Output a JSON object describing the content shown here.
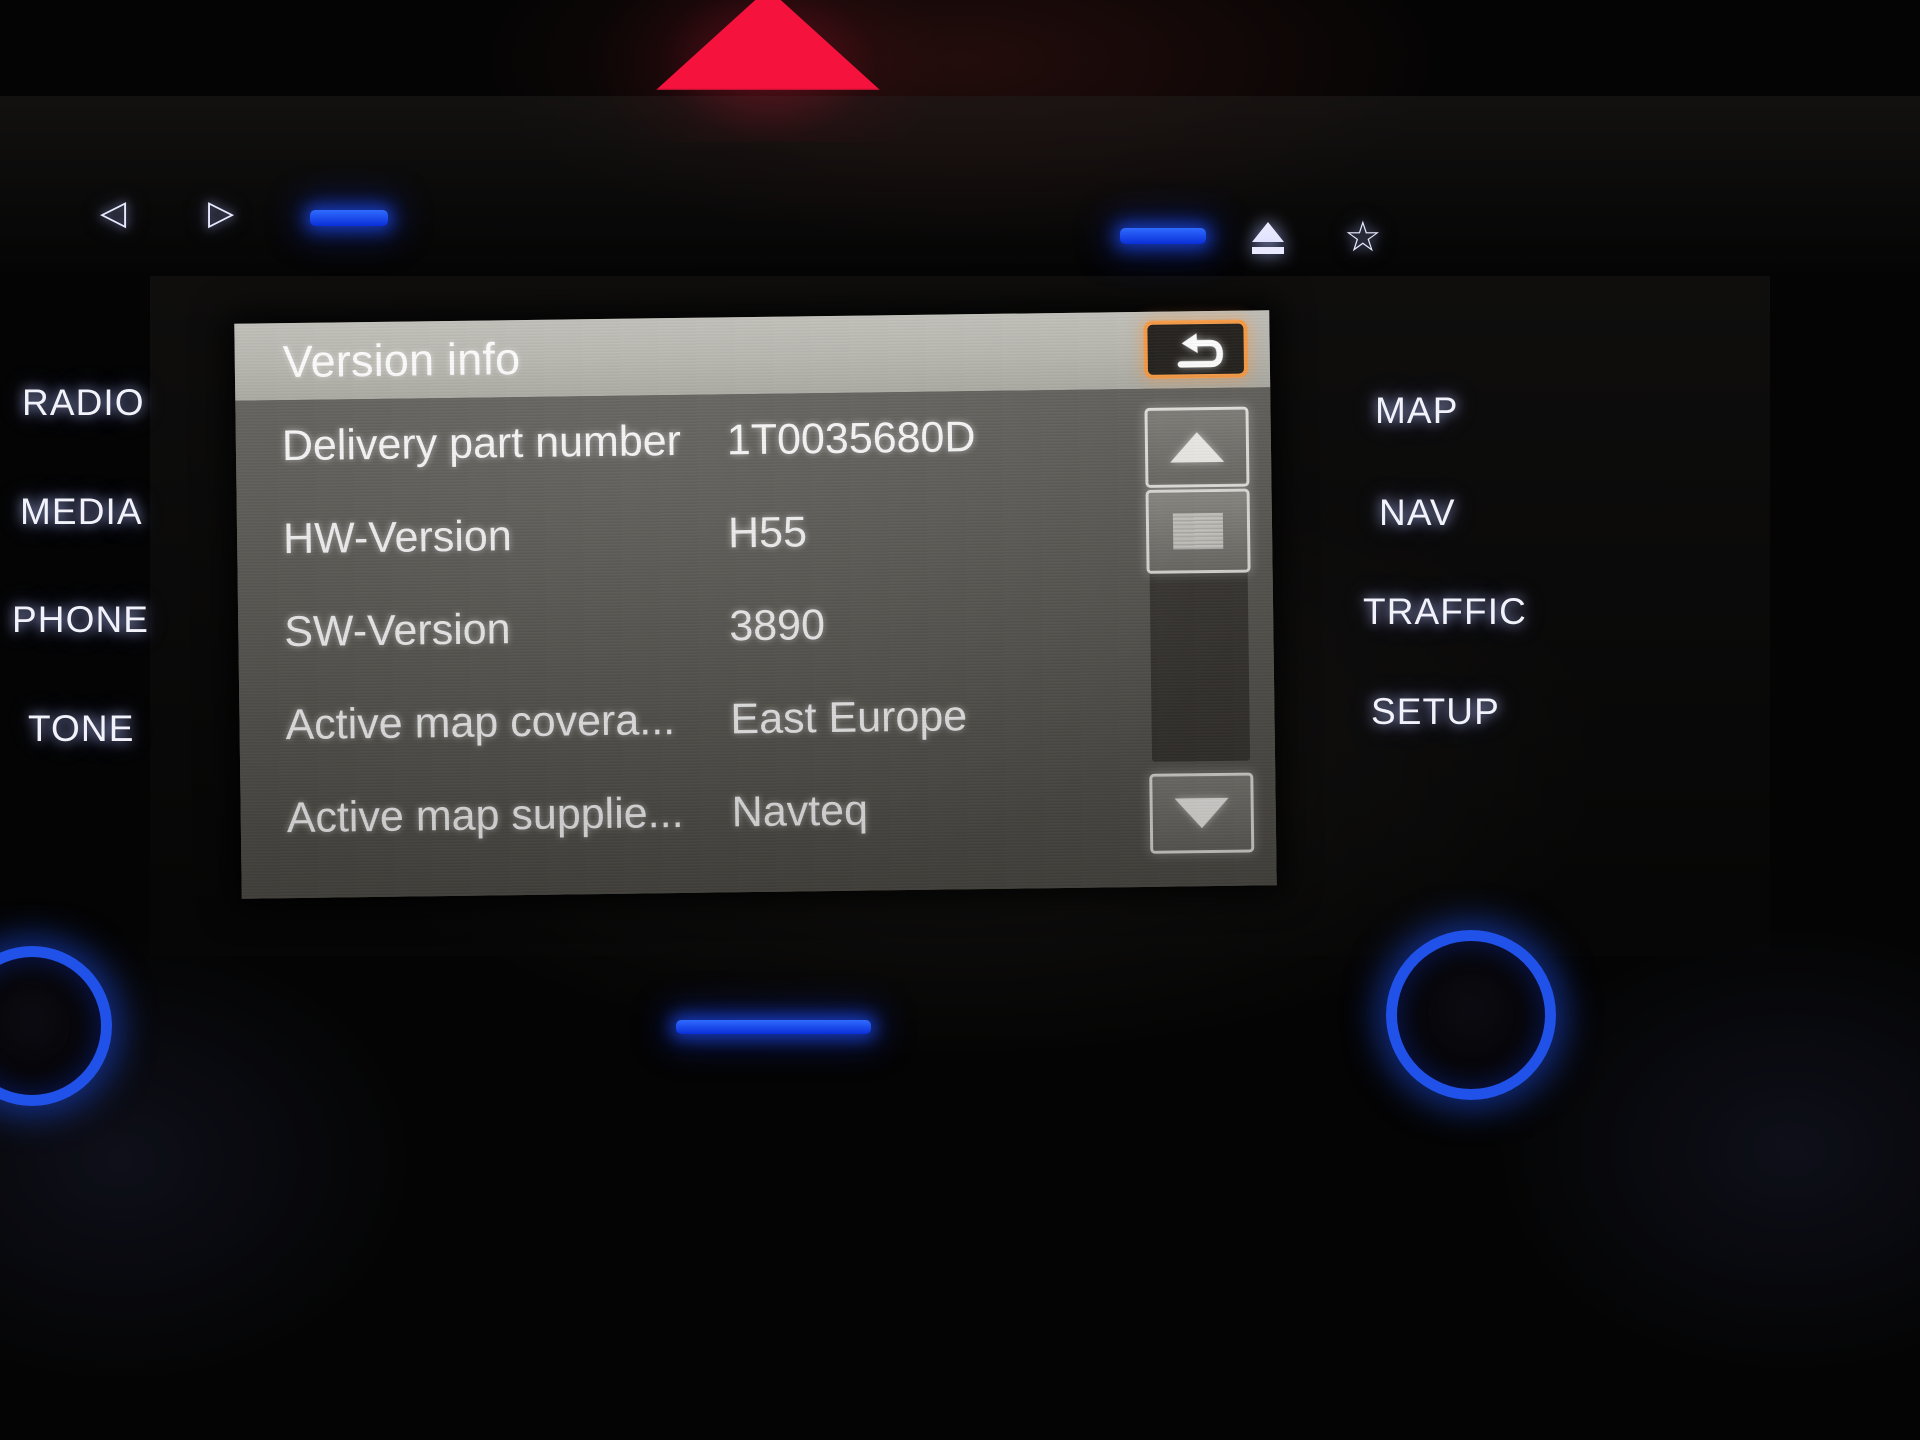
{
  "device": {
    "name": "car-infotainment-head-unit"
  },
  "hardware_left": {
    "buttons": [
      {
        "label": "RADIO",
        "icon": "radio-button"
      },
      {
        "label": "MEDIA",
        "icon": "media-button"
      },
      {
        "label": "PHONE",
        "icon": "phone-button"
      },
      {
        "label": "TONE",
        "icon": "tone-button"
      }
    ]
  },
  "hardware_right": {
    "buttons": [
      {
        "label": "MAP",
        "icon": "map-button"
      },
      {
        "label": "NAV",
        "icon": "nav-button"
      },
      {
        "label": "TRAFFIC",
        "icon": "traffic-button"
      },
      {
        "label": "SETUP",
        "icon": "setup-button"
      }
    ]
  },
  "hardware_top": {
    "prev_icon": "previous-track-icon",
    "prev_glyph": "◁",
    "next_icon": "next-track-icon",
    "next_glyph": "▷",
    "eject_icon": "eject-icon",
    "favorite_icon": "star-icon",
    "favorite_glyph": "☆",
    "hazard_icon": "hazard-warning-triangle"
  },
  "screen": {
    "title": "Version info",
    "back_button": {
      "icon": "back-arrow-icon",
      "accent_color": "#f6963d"
    },
    "rows": [
      {
        "label": "Delivery part number",
        "value": "1T0035680D"
      },
      {
        "label": "HW-Version",
        "value": "H55"
      },
      {
        "label": "SW-Version",
        "value": "3890"
      },
      {
        "label": "Active map covera...",
        "value": "East Europe"
      },
      {
        "label": "Active map supplie...",
        "value": "Navteq"
      }
    ],
    "scrollbar": {
      "up_icon": "scroll-up-arrow-icon",
      "down_icon": "scroll-down-arrow-icon",
      "thumb_icon": "scroll-thumb"
    },
    "colors": {
      "titlebar": "#b4b3ab",
      "list_background": "#57554f",
      "text": "#ffffff",
      "accent": "#f6963d"
    }
  }
}
